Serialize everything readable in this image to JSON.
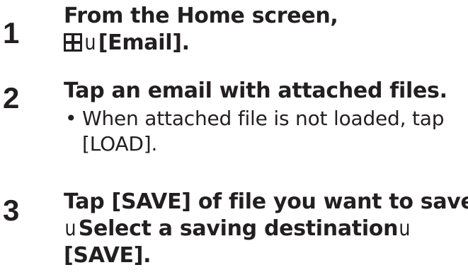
{
  "steps": [
    {
      "number": "1",
      "lines": [
        {
          "parts": [
            "From the Home screen,"
          ]
        },
        {
          "icon": "apps-grid-icon",
          "sep": "u",
          "parts": [
            "[Email]."
          ]
        }
      ]
    },
    {
      "number": "2",
      "title": "Tap an email with attached files.",
      "note_bullet": "•",
      "note_lines": [
        "When attached file is not loaded, tap",
        "[LOAD]."
      ]
    },
    {
      "number": "3",
      "line1": "Tap [SAVE] of file you want to save",
      "line2_sep": "u",
      "line2_text": "Select a saving destination",
      "line2_sep2": "u",
      "line3": "[SAVE]."
    }
  ],
  "colors": {
    "text": "#231f20"
  }
}
